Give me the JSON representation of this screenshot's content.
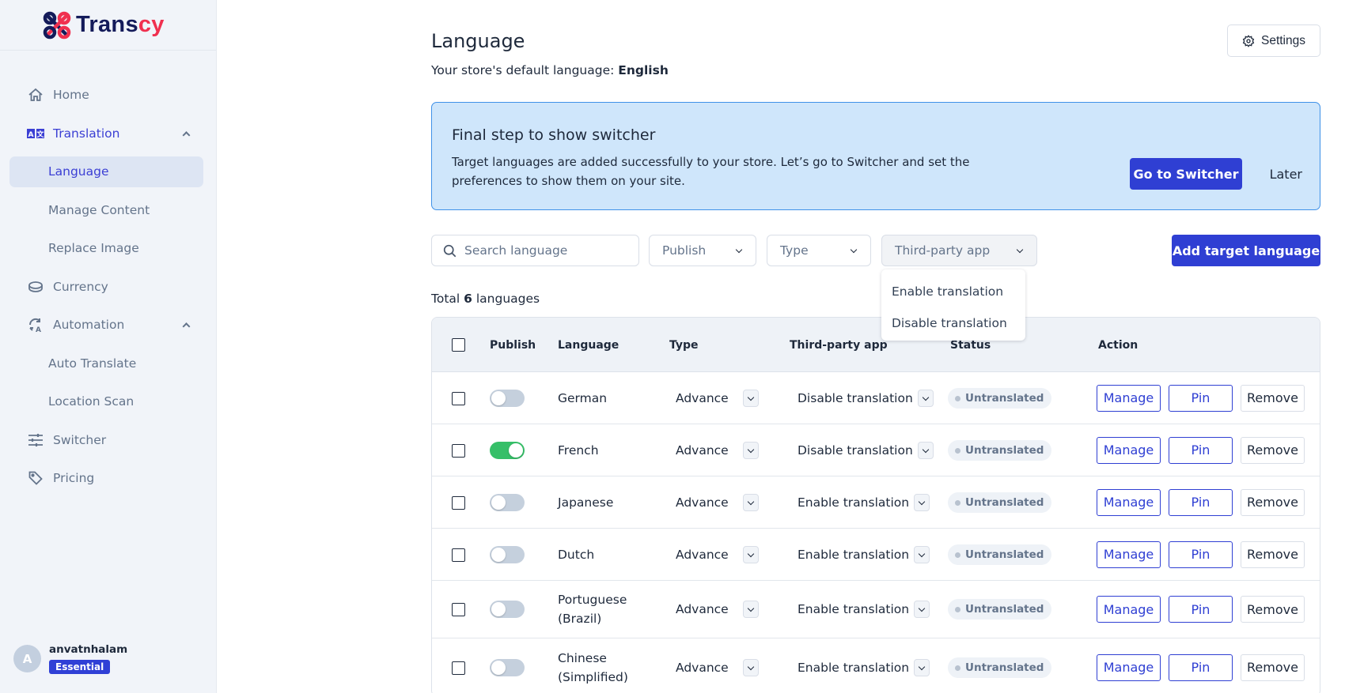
{
  "brand": {
    "name_main": "Trans",
    "name_accent": "cy",
    "accent_color": "#f0304f",
    "primary_color": "#141b5a"
  },
  "sidebar": {
    "items": [
      {
        "label": "Home",
        "icon": "home-icon"
      },
      {
        "label": "Translation",
        "icon": "translate-icon",
        "expanded": true,
        "children": [
          {
            "label": "Language",
            "active": true
          },
          {
            "label": "Manage Content"
          },
          {
            "label": "Replace Image"
          }
        ]
      },
      {
        "label": "Currency",
        "icon": "coin-icon"
      },
      {
        "label": "Automation",
        "icon": "auto-translate-icon",
        "expanded": true,
        "children": [
          {
            "label": "Auto Translate"
          },
          {
            "label": "Location Scan"
          }
        ]
      },
      {
        "label": "Switcher",
        "icon": "sliders-icon"
      },
      {
        "label": "Pricing",
        "icon": "tag-icon"
      }
    ],
    "user": {
      "avatar_initial": "A",
      "name": "anvatnhalam",
      "plan": "Essential"
    }
  },
  "header": {
    "title": "Language",
    "default_language_label": "Your store's default language:",
    "default_language": "English",
    "settings_label": "Settings"
  },
  "banner": {
    "title": "Final step to show switcher",
    "text": "Target languages are added successfully to your store. Let’s go to Switcher and set the preferences to show them on your site.",
    "primary_label": "Go to Switcher",
    "secondary_label": "Later"
  },
  "filters": {
    "search_placeholder": "Search language",
    "search_value": "",
    "publish_label": "Publish",
    "type_label": "Type",
    "third_party_label": "Third-party app",
    "add_label": "Add target language",
    "third_party_options": [
      "Enable translation",
      "Disable translation"
    ]
  },
  "summary": {
    "prefix": "Total",
    "count": "6",
    "suffix": "languages"
  },
  "table": {
    "columns": [
      "Publish",
      "Language",
      "Type",
      "Third-party app",
      "Status",
      "Action"
    ],
    "actions": {
      "manage": "Manage",
      "pin": "Pin",
      "remove": "Remove"
    },
    "rows": [
      {
        "published": false,
        "language": "German",
        "type": "Advance",
        "third_party": "Disable translation",
        "status": "Untranslated"
      },
      {
        "published": true,
        "language": "French",
        "type": "Advance",
        "third_party": "Disable translation",
        "status": "Untranslated"
      },
      {
        "published": false,
        "language": "Japanese",
        "type": "Advance",
        "third_party": "Enable translation",
        "status": "Untranslated"
      },
      {
        "published": false,
        "language": "Dutch",
        "type": "Advance",
        "third_party": "Enable translation",
        "status": "Untranslated"
      },
      {
        "published": false,
        "language": "Portuguese (Brazil)",
        "type": "Advance",
        "third_party": "Enable translation",
        "status": "Untranslated"
      },
      {
        "published": false,
        "language": "Chinese (Simplified)",
        "type": "Advance",
        "third_party": "Enable translation",
        "status": "Untranslated"
      }
    ]
  }
}
